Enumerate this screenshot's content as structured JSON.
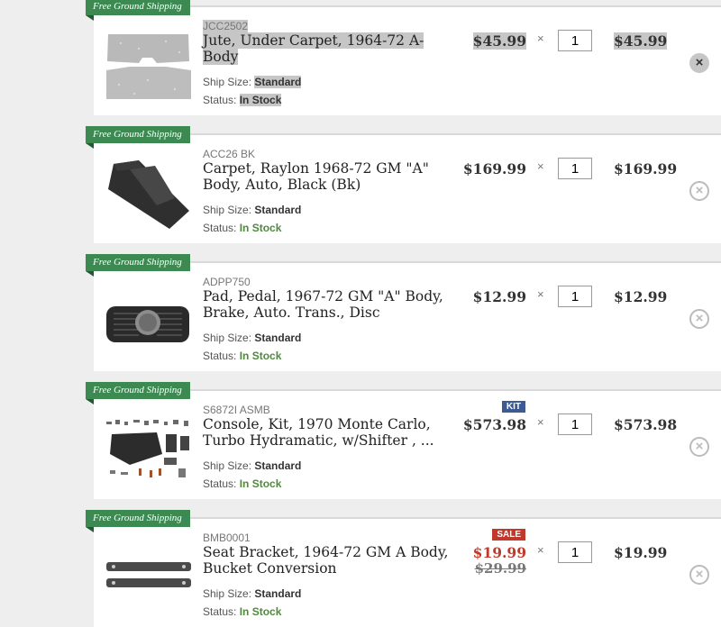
{
  "ribbon_text": "Free Ground Shipping",
  "labels": {
    "ship_size": "Ship Size:",
    "status": "Status:",
    "times": "×",
    "remove": "×"
  },
  "colors": {
    "ribbon": "#3c8a52",
    "in_stock": "#4f8a3c",
    "sale": "#c0392b",
    "kit_badge": "#3b5b92",
    "sale_badge": "#c0392b"
  },
  "items": [
    {
      "sku": "JCC2502",
      "name": "Jute, Under Carpet, 1964-72 A-Body",
      "ship_size": "Standard",
      "status": "In Stock",
      "price": "$45.99",
      "qty": "1",
      "total": "$45.99",
      "image_icon": "jute-pad-image"
    },
    {
      "sku": "ACC26 BK",
      "name": "Carpet, Raylon 1968-72 GM \"A\" Body, Auto, Black (Bk)",
      "ship_size": "Standard",
      "status": "In Stock",
      "price": "$169.99",
      "qty": "1",
      "total": "$169.99",
      "image_icon": "carpet-image"
    },
    {
      "sku": "ADPP750",
      "name": "Pad, Pedal, 1967-72 GM \"A\" Body, Brake, Auto. Trans., Disc",
      "ship_size": "Standard",
      "status": "In Stock",
      "price": "$12.99",
      "qty": "1",
      "total": "$12.99",
      "image_icon": "pedal-pad-image"
    },
    {
      "sku": "S6872I ASMB",
      "name": "Console, Kit, 1970 Monte Carlo, Turbo Hydramatic, w/Shifter , ...",
      "ship_size": "Standard",
      "status": "In Stock",
      "badge": "KIT",
      "price": "$573.98",
      "qty": "1",
      "total": "$573.98",
      "image_icon": "console-kit-image"
    },
    {
      "sku": "BMB0001",
      "name": "Seat Bracket, 1964-72 GM A Body, Bucket Conversion",
      "ship_size": "Standard",
      "status": "In Stock",
      "badge": "SALE",
      "price": "$19.99",
      "old_price": "$29.99",
      "qty": "1",
      "total": "$19.99",
      "image_icon": "seat-bracket-image"
    }
  ]
}
